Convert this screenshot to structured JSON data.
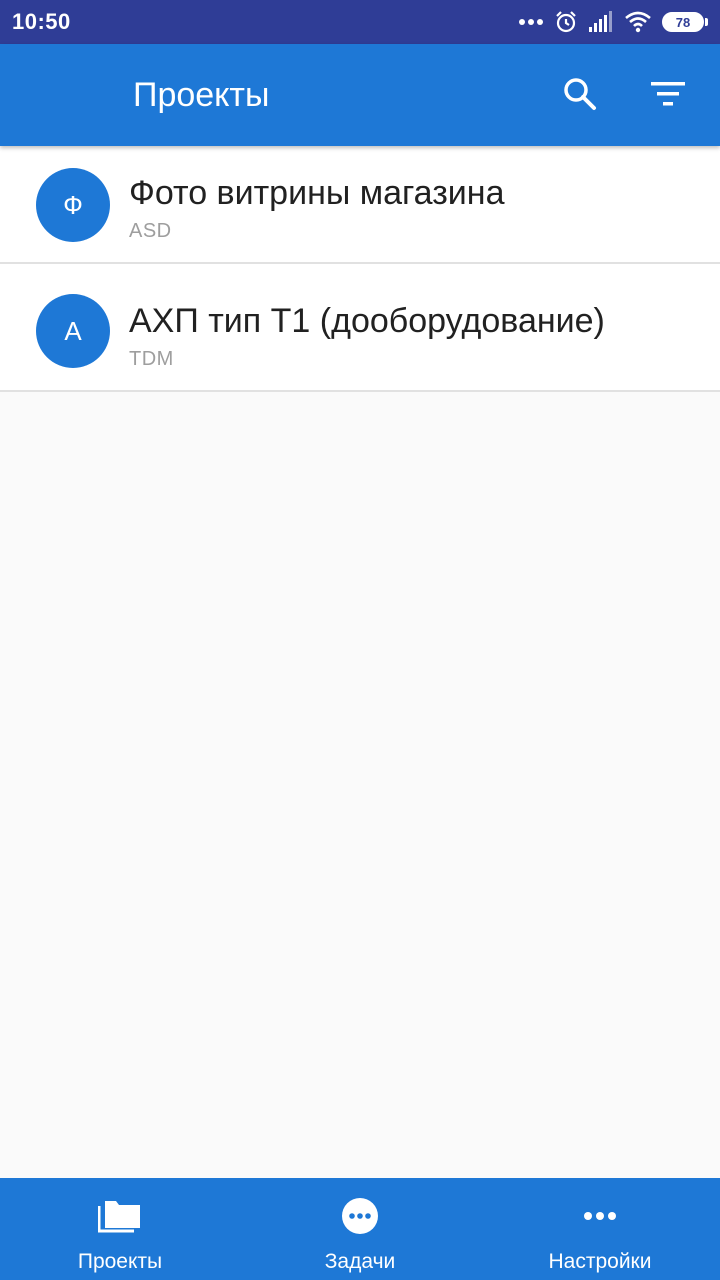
{
  "status_bar": {
    "time": "10:50",
    "battery_level": "78",
    "icons": [
      "more-dots-icon",
      "alarm-icon",
      "signal-icon",
      "wifi-icon",
      "battery-icon"
    ]
  },
  "app_bar": {
    "title": "Проекты",
    "actions": [
      "search-icon",
      "filter-icon"
    ],
    "color": "#1e78d6"
  },
  "projects": [
    {
      "avatar_letter": "Ф",
      "name": "Фото витрины магазина",
      "code": "ASD"
    },
    {
      "avatar_letter": "А",
      "name": "АХП тип Т1 (дооборудование)",
      "code": "TDM"
    }
  ],
  "bottom_nav": {
    "items": [
      {
        "label": "Проекты",
        "icon": "folder-icon"
      },
      {
        "label": "Задачи",
        "icon": "tasks-dots-circle-icon"
      },
      {
        "label": "Настройки",
        "icon": "more-dots-icon"
      }
    ]
  },
  "colors": {
    "status_bar": "#2f3d96",
    "primary": "#1e78d6",
    "background": "#fafafa"
  }
}
